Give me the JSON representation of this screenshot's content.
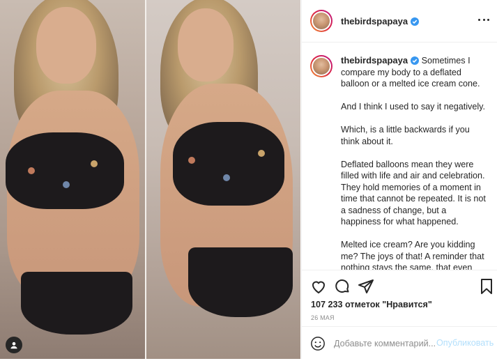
{
  "post": {
    "username": "thebirdspapaya",
    "caption_paragraphs": [
      "Sometimes I compare my body to a deflated balloon or a melted ice cream cone.",
      "And I think I used to say it negatively.",
      "Which, is a little backwards if you think about it.",
      "Deflated balloons mean they were filled with life and air and celebration. They hold memories of a moment in time that cannot be repeated. It is not a sadness of change, but a happiness for what happened.",
      "Melted ice cream? Are you kidding me? The joys of that! A reminder that nothing stays the same, that even perfect ice cream scoops to be"
    ],
    "likes_text": "107 233 отметок \"Нравится\"",
    "date_text": "26 МАЯ"
  },
  "comment": {
    "placeholder": "Добавьте комментарий...",
    "post_label": "Опубликовать"
  },
  "icons": {
    "verified": "verified-badge-icon",
    "more": "more-options-icon",
    "like": "heart-icon",
    "comment": "comment-icon",
    "share": "share-icon",
    "save": "bookmark-icon",
    "emoji": "smiley-icon",
    "profile_badge": "user-tag-icon"
  },
  "colors": {
    "verified": "#3897f0",
    "post_button_disabled": "#b2dffc",
    "secondary_text": "#8e8e8e",
    "border": "#efefef"
  }
}
